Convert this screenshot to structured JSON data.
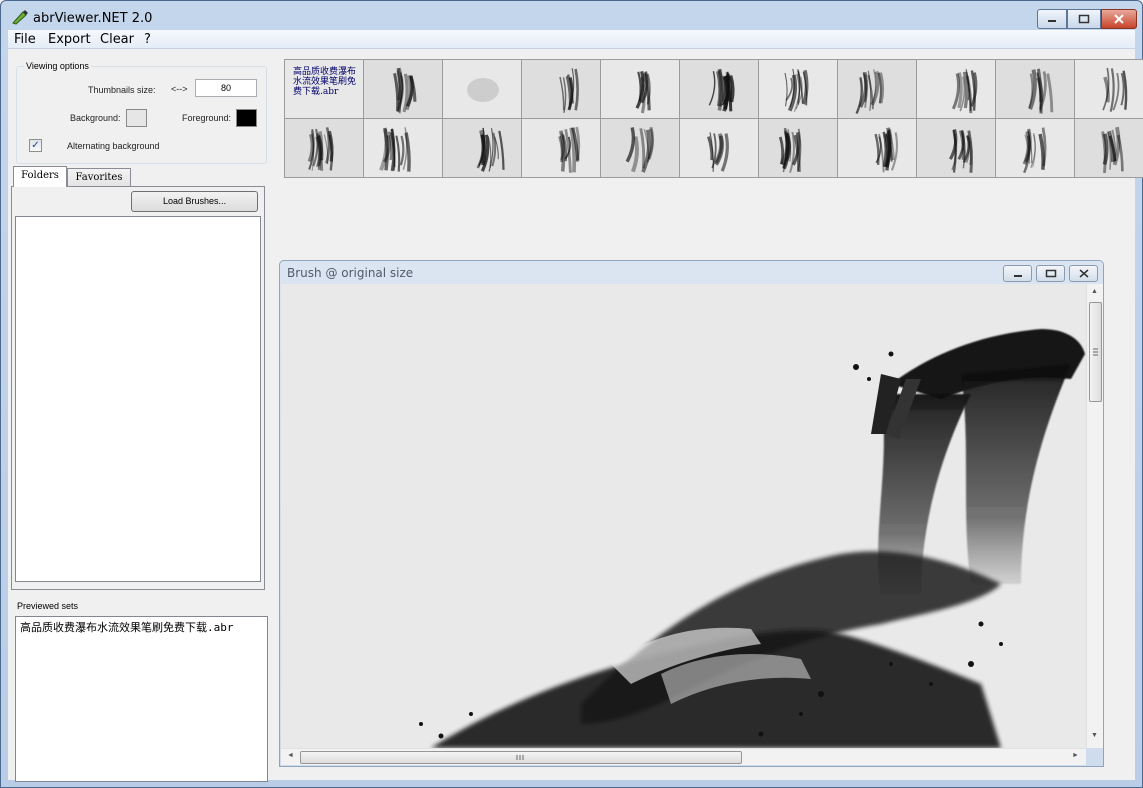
{
  "window": {
    "title": "abrViewer.NET 2.0"
  },
  "menu": [
    "File",
    "Export",
    "Clear",
    "?"
  ],
  "viewing_options": {
    "legend": "Viewing options",
    "thumb_size_label": "Thumbnails size:",
    "arrow_label": "<-->",
    "thumb_size_value": "80",
    "background_label": "Background:",
    "background_color": "#e6e6e6",
    "foreground_label": "Foreground:",
    "foreground_color": "#000000",
    "alternating_label": "Alternating background",
    "alternating_checked": true,
    "check_glyph": "✓"
  },
  "tabs": {
    "folders": "Folders",
    "favorites": "Favorites"
  },
  "load_button": "Load Brushes...",
  "previewed": {
    "label": "Previewed sets",
    "items": [
      "高品质收费瀑布水流效果笔刷免费下载.abr"
    ]
  },
  "thumbnails": {
    "set_title": "高品质收费瀑布水流效果笔刷免费下载.abr",
    "count": 21
  },
  "brush_window": {
    "title": "Brush @ original size"
  },
  "icons": {
    "app": "brush-icon",
    "minimize": "minimize-icon",
    "maximize": "maximize-icon",
    "close": "close-icon",
    "grip": "scroll-grip-icon",
    "left": "◄",
    "right": "►",
    "up": "▲",
    "down": "▼"
  }
}
